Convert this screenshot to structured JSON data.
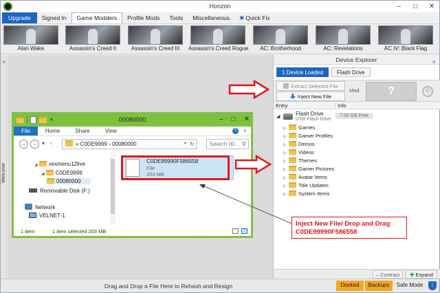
{
  "app": {
    "title": "Horizon",
    "window_buttons": [
      "–",
      "□",
      "✕"
    ]
  },
  "menu": {
    "items": [
      "Upgrade",
      "Signed In",
      "Game Modders",
      "Profile Mods",
      "Tools",
      "Miscellaneous",
      "Quick Fix"
    ],
    "selected": "Game Modders"
  },
  "games": [
    "Alan Wake",
    "Assassin's Creed II",
    "Assassin's Creed III",
    "Assassin's Creed Rogue",
    "AC: Brotherhood",
    "AC: Revelations",
    "AC IV: Black Flag"
  ],
  "side_panel": {
    "collapse_left": "»",
    "collapse_right": "»",
    "vertical_tab": "Welcome"
  },
  "device_explorer": {
    "title": "Device Explorer",
    "tabs": [
      "1 Device Loaded",
      "Flash Drive"
    ],
    "extract_button": "Extract Selected File",
    "inject_button": "Inject New File",
    "mod_label": "Mod",
    "mod_placeholder": "?",
    "columns": {
      "entry": "Entry",
      "info": "Info"
    },
    "drive": {
      "name": "Flash Drive",
      "type": "USB Flash Drive",
      "size": "7.00 GB Free"
    },
    "folders": [
      "Games",
      "Gamer Profiles",
      "Demos",
      "Videos",
      "Themes",
      "Gamer Pictures",
      "Avatar Items",
      "Title Updates",
      "System Items"
    ],
    "contract_button": "Contract",
    "expand_button": "Expand"
  },
  "status_bar": {
    "message": "Drag and Drop a File Here to Rehash and Resign",
    "docked": "Docked",
    "backups": "Backups",
    "safe_mode": "Safe Mode"
  },
  "windows_explorer": {
    "title": "00080000",
    "ribbon_tabs": [
      "File",
      "Home",
      "Share",
      "View"
    ],
    "address": [
      "«",
      "C0DE9999",
      "›",
      "00080000"
    ],
    "search_placeholder": "Search 00...",
    "nav": {
      "xexmenu": "xexmenu12live",
      "code": "C0DE9999",
      "folder": "00080000",
      "removable": "Removable Disk (F:)",
      "network": "Network",
      "pc": "VELNET-1"
    },
    "file": {
      "name": "C0DE99990F586558",
      "type": "File",
      "size": "203 MB"
    },
    "status": {
      "count": "1 item",
      "selection": "1 item selected  203 MB"
    }
  },
  "annotation": {
    "line1": "Inject New File/ Drop and Drag",
    "line2": "C0DE99990F586558",
    "color": "#e0151b"
  }
}
